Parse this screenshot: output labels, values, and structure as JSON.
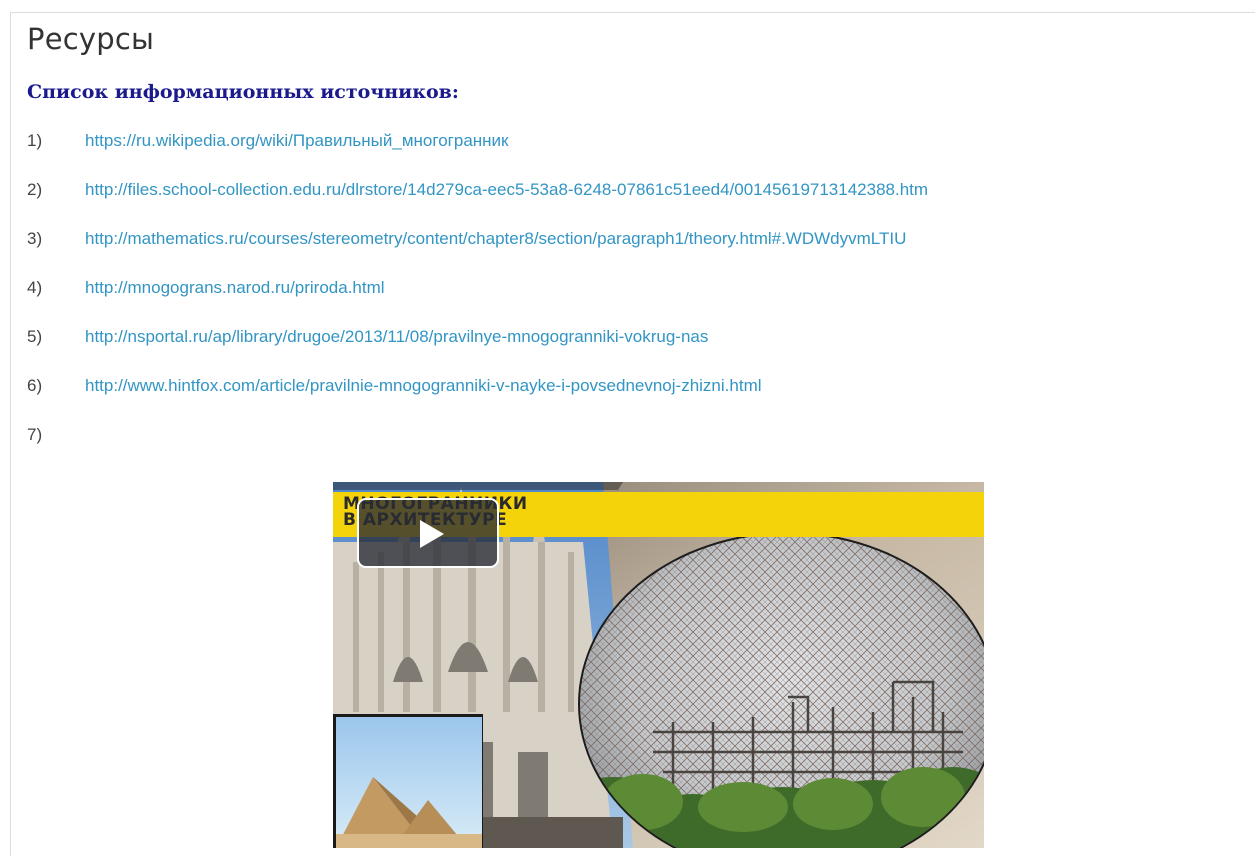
{
  "page": {
    "title": "Ресурсы",
    "subtitle": "Список информационных источников:"
  },
  "sources": [
    {
      "num": "1)",
      "url": "https://ru.wikipedia.org/wiki/Правильный_многогранник"
    },
    {
      "num": "2)",
      "url": "http://files.school-collection.edu.ru/dlrstore/14d279ca-eec5-53a8-6248-07861c51eed4/00145619713142388.htm"
    },
    {
      "num": "3)",
      "url": "http://mathematics.ru/courses/stereometry/content/chapter8/section/paragraph1/theory.html#.WDWdyvmLTIU"
    },
    {
      "num": "4)",
      "url": "http://mnogograns.narod.ru/priroda.html"
    },
    {
      "num": "5)",
      "url": "http://nsportal.ru/ap/library/drugoe/2013/11/08/pravilnye-mnogogranniki-vokrug-nas"
    },
    {
      "num": "6)",
      "url": "http://www.hintfox.com/article/pravilnie-mnogogranniki-v-nayke-i-povsednevnoj-zhizni.html"
    },
    {
      "num": "7)",
      "url": ""
    }
  ],
  "video": {
    "banner_line1": "МНОГОГРАННИКИ",
    "banner_line2": "В АРХИТЕКТУРЕ",
    "play_icon": "play-icon"
  },
  "colors": {
    "link": "#3295c4",
    "subtitle": "#1a1a8c",
    "banner": "#f5d30a"
  }
}
